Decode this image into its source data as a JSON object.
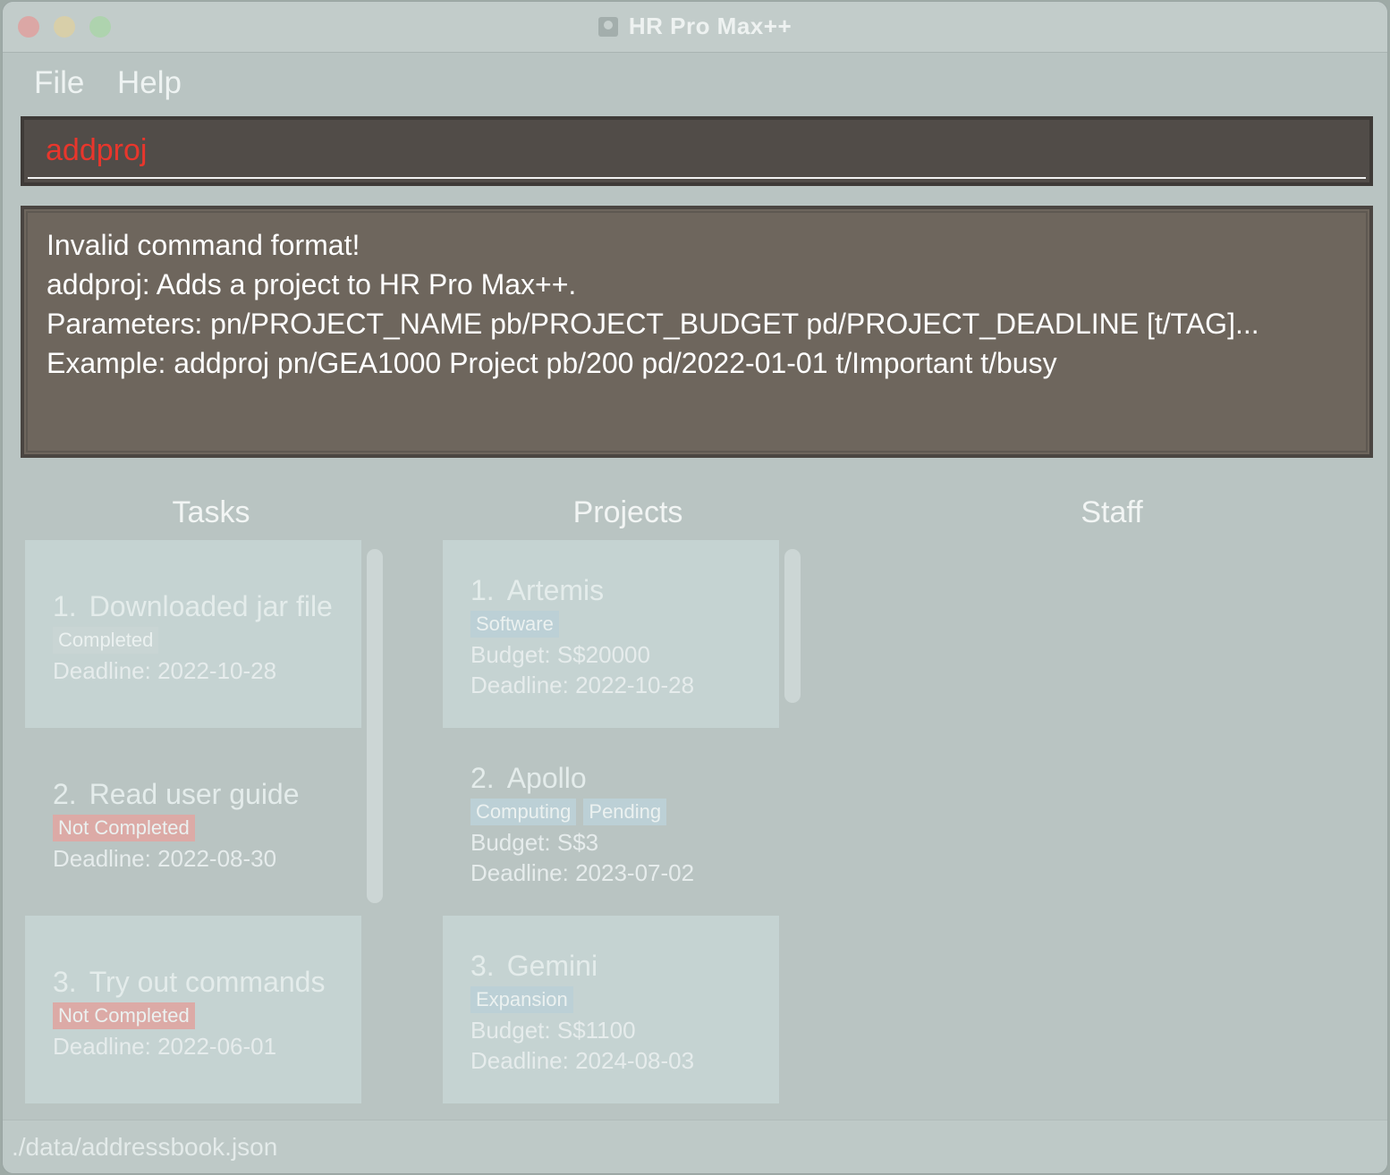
{
  "window": {
    "title": "HR Pro Max++"
  },
  "menu": {
    "file": "File",
    "help": "Help"
  },
  "command": {
    "value": "addproj"
  },
  "result": {
    "lines": [
      "Invalid command format!",
      "addproj: Adds a project to HR Pro Max++.",
      "Parameters: pn/PROJECT_NAME pb/PROJECT_BUDGET pd/PROJECT_DEADLINE [t/TAG]...",
      "Example: addproj pn/GEA1000 Project pb/200 pd/2022-01-01 t/Important t/busy"
    ]
  },
  "panels": {
    "tasks": "Tasks",
    "projects": "Projects",
    "staff": "Staff"
  },
  "tasks": [
    {
      "index": "1.",
      "name": "Downloaded jar file",
      "status": "Completed",
      "deadline": "Deadline: 2022-10-28"
    },
    {
      "index": "2.",
      "name": "Read user guide",
      "status": "Not Completed",
      "deadline": "Deadline: 2022-08-30"
    },
    {
      "index": "3.",
      "name": "Try out commands",
      "status": "Not Completed",
      "deadline": "Deadline: 2022-06-01"
    }
  ],
  "projects": [
    {
      "index": "1.",
      "name": "Artemis",
      "tags": [
        "Software"
      ],
      "budget": "Budget: S$20000",
      "deadline": "Deadline: 2022-10-28"
    },
    {
      "index": "2.",
      "name": "Apollo",
      "tags": [
        "Computing",
        "Pending"
      ],
      "budget": "Budget: S$3",
      "deadline": "Deadline: 2023-07-02"
    },
    {
      "index": "3.",
      "name": "Gemini",
      "tags": [
        "Expansion"
      ],
      "budget": "Budget: S$1100",
      "deadline": "Deadline: 2024-08-03"
    }
  ],
  "status": {
    "path": "./data/addressbook.json"
  },
  "colors": {
    "command_text": "#e8362c",
    "completed_tag": "#c9d5d4",
    "not_completed_tag": "#dcaaa6",
    "project_tag": "#bcd0d6"
  }
}
